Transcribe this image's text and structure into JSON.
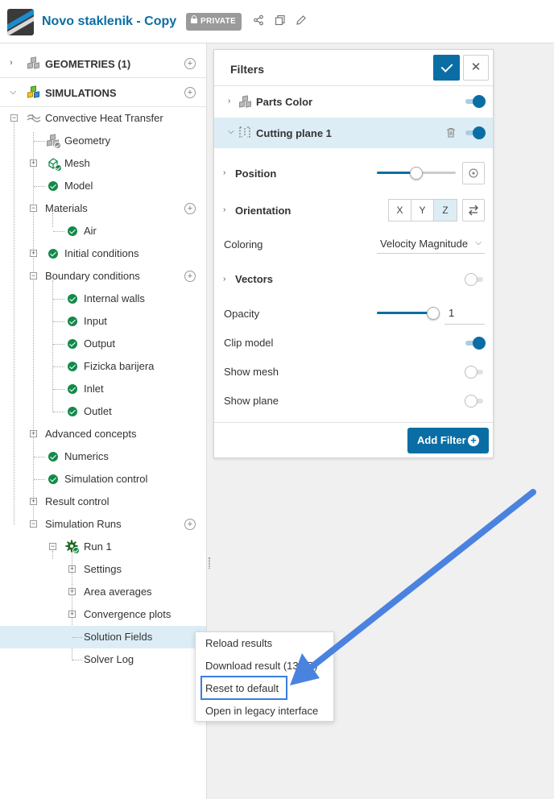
{
  "header": {
    "project_title": "Novo staklenik - Copy",
    "privacy_badge": "PRIVATE",
    "icons": [
      "share-icon",
      "copy-icon",
      "edit-icon"
    ]
  },
  "sidebar": {
    "geometries_label": "GEOMETRIES (1)",
    "simulations_label": "SIMULATIONS",
    "tree": {
      "convective": "Convective Heat Transfer",
      "geometry": "Geometry",
      "mesh": "Mesh",
      "model": "Model",
      "materials": "Materials",
      "air": "Air",
      "initial_conditions": "Initial conditions",
      "boundary_conditions": "Boundary conditions",
      "internal_walls": "Internal walls",
      "input": "Input",
      "output": "Output",
      "fizicka_barijera": "Fizicka barijera",
      "inlet": "Inlet",
      "outlet": "Outlet",
      "advanced_concepts": "Advanced concepts",
      "numerics": "Numerics",
      "simulation_control": "Simulation control",
      "result_control": "Result control",
      "simulation_runs": "Simulation Runs",
      "run1": "Run 1",
      "settings": "Settings",
      "area_averages": "Area averages",
      "convergence_plots": "Convergence plots",
      "solution_fields": "Solution Fields",
      "solver_log": "Solver Log"
    }
  },
  "filters": {
    "title": "Filters",
    "parts_color": "Parts Color",
    "cutting_plane": "Cutting plane 1",
    "position": "Position",
    "position_value": 0.5,
    "orientation": "Orientation",
    "axes": [
      "X",
      "Y",
      "Z"
    ],
    "active_axis": "Z",
    "coloring": "Coloring",
    "coloring_value": "Velocity Magnitude",
    "vectors": "Vectors",
    "opacity": "Opacity",
    "opacity_value": "1",
    "clip_model": "Clip model",
    "show_mesh": "Show mesh",
    "show_plane": "Show plane",
    "add_filter": "Add Filter",
    "toggles": {
      "parts_color": true,
      "cutting_plane": true,
      "vectors": false,
      "clip_model": true,
      "show_mesh": false,
      "show_plane": false
    }
  },
  "context_menu": {
    "items": [
      "Reload results",
      "Download result (13MB)",
      "Reset to default",
      "Open in legacy interface"
    ],
    "highlighted": "Reset to default"
  },
  "colors": {
    "accent": "#0a6ea5",
    "success": "#128a4a",
    "arrow": "#4a82e0",
    "selection": "#ddedf5"
  }
}
